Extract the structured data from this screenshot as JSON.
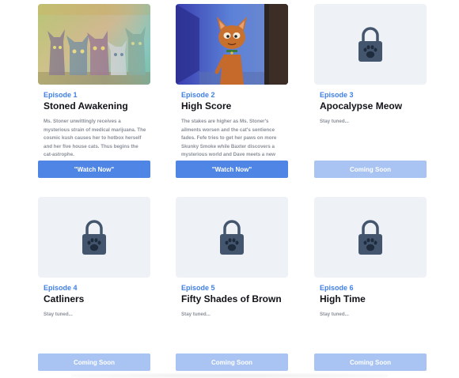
{
  "episodes": [
    {
      "label": "Episode 1",
      "title": "Stoned Awakening",
      "description": "Ms. Stoner unwittingly receives a mysterious strain of medical marijuana. The cosmic kush causes her to hotbox herself and her five house cats. Thus begins the cat-astrophe.",
      "button": "\"Watch Now\"",
      "thumbnail": "cats-scene"
    },
    {
      "label": "Episode 2",
      "title": "High Score",
      "description": "The stakes are higher as Ms. Stoner's ailments worsen and the cat's sentience fades. Fefe tries to get her paws on more Skunky Smoke while Baxter discovers a mysterious world and Dave meets a new friend.",
      "button": "\"Watch Now\"",
      "thumbnail": "cat-hallway"
    },
    {
      "label": "Episode 3",
      "title": "Apocalypse Meow",
      "description": "Stay tuned...",
      "button": "Coming Soon",
      "thumbnail": "lock-paw-icon"
    },
    {
      "label": "Episode 4",
      "title": "Catliners",
      "description": "Stay tuned...",
      "button": "Coming Soon",
      "thumbnail": "lock-paw-icon"
    },
    {
      "label": "Episode 5",
      "title": "Fifty Shades of Brown",
      "description": "Stay tuned...",
      "button": "Coming Soon",
      "thumbnail": "lock-paw-icon"
    },
    {
      "label": "Episode 6",
      "title": "High Time",
      "description": "Stay tuned...",
      "button": "Coming Soon",
      "thumbnail": "lock-paw-icon"
    }
  ],
  "colors": {
    "accent": "#3f7fe6",
    "watch_button": "#4f86e6",
    "coming_soon_button": "#a9c4f2",
    "lock": "#44566e"
  }
}
